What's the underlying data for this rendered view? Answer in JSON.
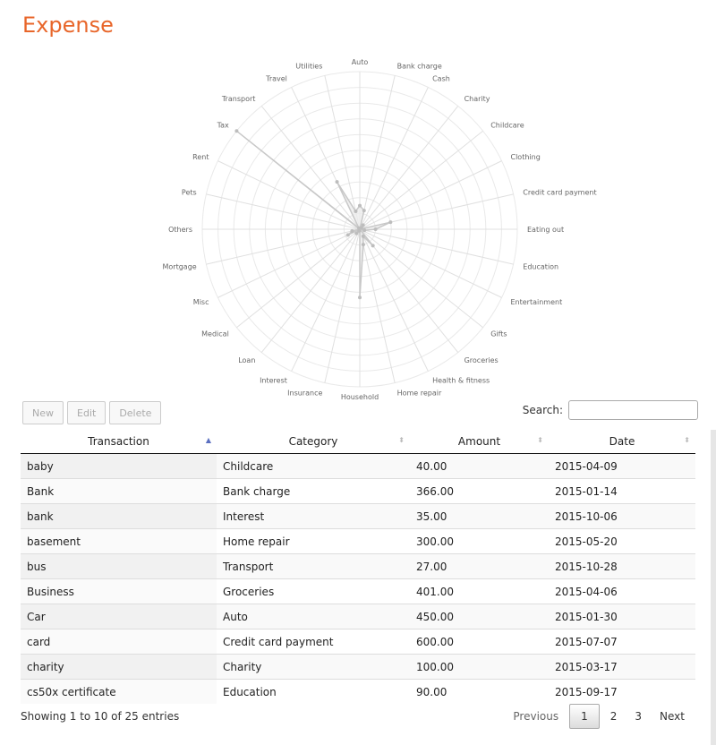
{
  "page": {
    "title": "Expense"
  },
  "chart_data": {
    "type": "radar",
    "categories": [
      "Auto",
      "Bank charge",
      "Cash",
      "Charity",
      "Childcare",
      "Clothing",
      "Credit card payment",
      "Eating out",
      "Education",
      "Entertainment",
      "Gifts",
      "Groceries",
      "Health & fitness",
      "Home repair",
      "Household",
      "Insurance",
      "Interest",
      "Loan",
      "Medical",
      "Misc",
      "Mortgage",
      "Others",
      "Pets",
      "Rent",
      "Tax",
      "Transport",
      "Travel",
      "Utilities"
    ],
    "values": [
      450,
      366,
      0,
      100,
      40,
      0,
      600,
      300,
      90,
      0,
      0,
      401,
      150,
      300,
      1300,
      0,
      35,
      100,
      0,
      250,
      150,
      0,
      0,
      0,
      3000,
      27,
      1000,
      350
    ],
    "rmax": 3000,
    "grid_rings": 10,
    "colors": {
      "grid": "#e9e9e9",
      "spoke": "#e0e0e0",
      "series_line": "#c8c8c8",
      "series_fill": "#ececec",
      "point": "#bdbdbd"
    }
  },
  "toolbar": {
    "new": "New",
    "edit": "Edit",
    "delete": "Delete"
  },
  "search": {
    "label": "Search:",
    "value": ""
  },
  "table": {
    "columns": [
      "Transaction",
      "Category",
      "Amount",
      "Date"
    ],
    "rows": [
      [
        "baby",
        "Childcare",
        "40.00",
        "2015-04-09"
      ],
      [
        "Bank",
        "Bank charge",
        "366.00",
        "2015-01-14"
      ],
      [
        "bank",
        "Interest",
        "35.00",
        "2015-10-06"
      ],
      [
        "basement",
        "Home repair",
        "300.00",
        "2015-05-20"
      ],
      [
        "bus",
        "Transport",
        "27.00",
        "2015-10-28"
      ],
      [
        "Business",
        "Groceries",
        "401.00",
        "2015-04-06"
      ],
      [
        "Car",
        "Auto",
        "450.00",
        "2015-01-30"
      ],
      [
        "card",
        "Credit card payment",
        "600.00",
        "2015-07-07"
      ],
      [
        "charity",
        "Charity",
        "100.00",
        "2015-03-17"
      ],
      [
        "cs50x certificate",
        "Education",
        "90.00",
        "2015-09-17"
      ]
    ]
  },
  "footer": {
    "info": "Showing 1 to 10 of 25 entries",
    "previous": "Previous",
    "pages": [
      "1",
      "2",
      "3"
    ],
    "current": "1",
    "next": "Next"
  }
}
